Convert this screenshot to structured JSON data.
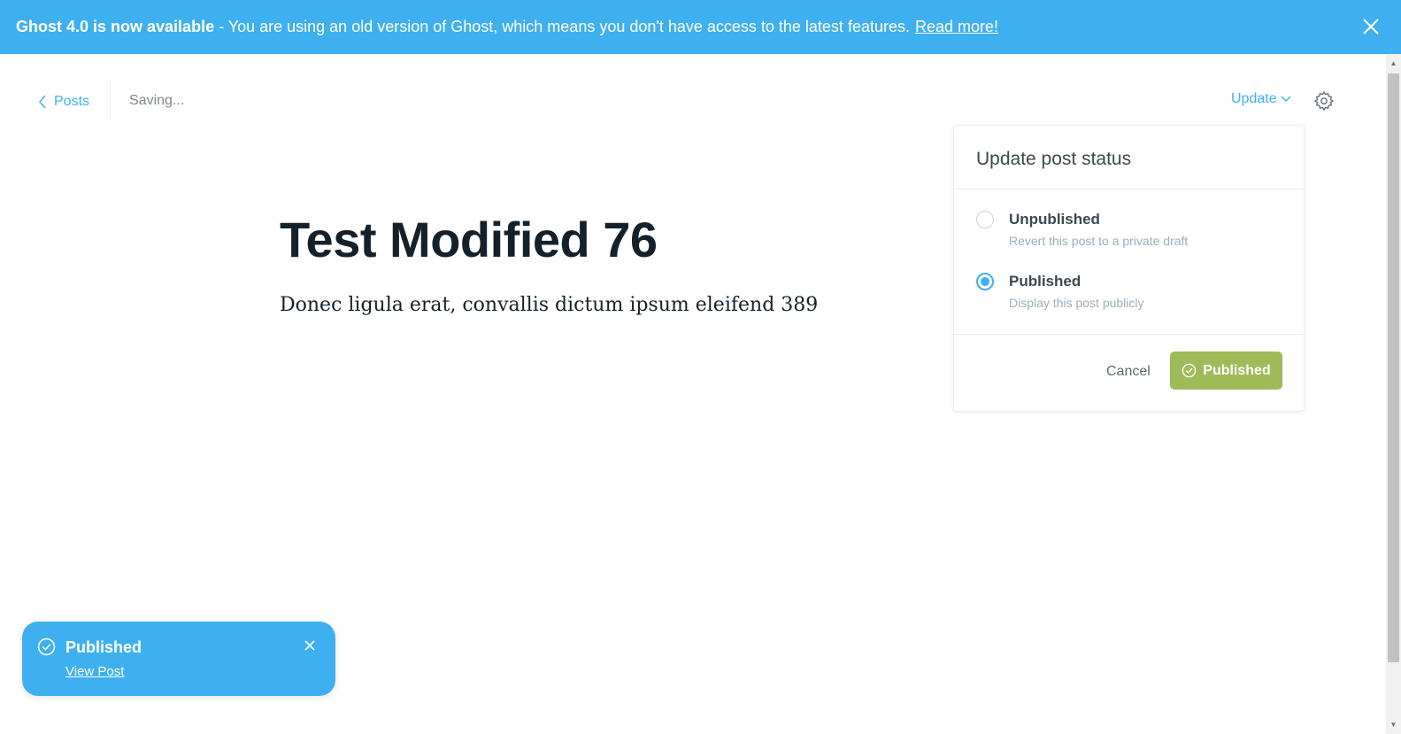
{
  "banner": {
    "bold_text": "Ghost 4.0 is now available",
    "message": "- You are using an old version of Ghost, which means you don't have access to the latest features.",
    "link_text": "Read more!",
    "close_icon": "close-icon"
  },
  "header": {
    "back_label": "Posts",
    "status_text": "Saving...",
    "update_label": "Update",
    "settings_icon": "gear-icon"
  },
  "post": {
    "title": "Test Modified 76",
    "body": "Donec ligula erat, convallis dictum ipsum eleifend 389"
  },
  "status_panel": {
    "title": "Update post status",
    "options": [
      {
        "label": "Unpublished",
        "description": "Revert this post to a private draft",
        "selected": false
      },
      {
        "label": "Published",
        "description": "Display this post publicly",
        "selected": true
      }
    ],
    "cancel_label": "Cancel",
    "confirm_label": "Published"
  },
  "toast": {
    "title": "Published",
    "link_text": "View Post"
  },
  "colors": {
    "accent": "#3eb0ef",
    "publish_green": "#9fbb58",
    "text_dark": "#15212a",
    "text_muted": "#7d878a"
  }
}
